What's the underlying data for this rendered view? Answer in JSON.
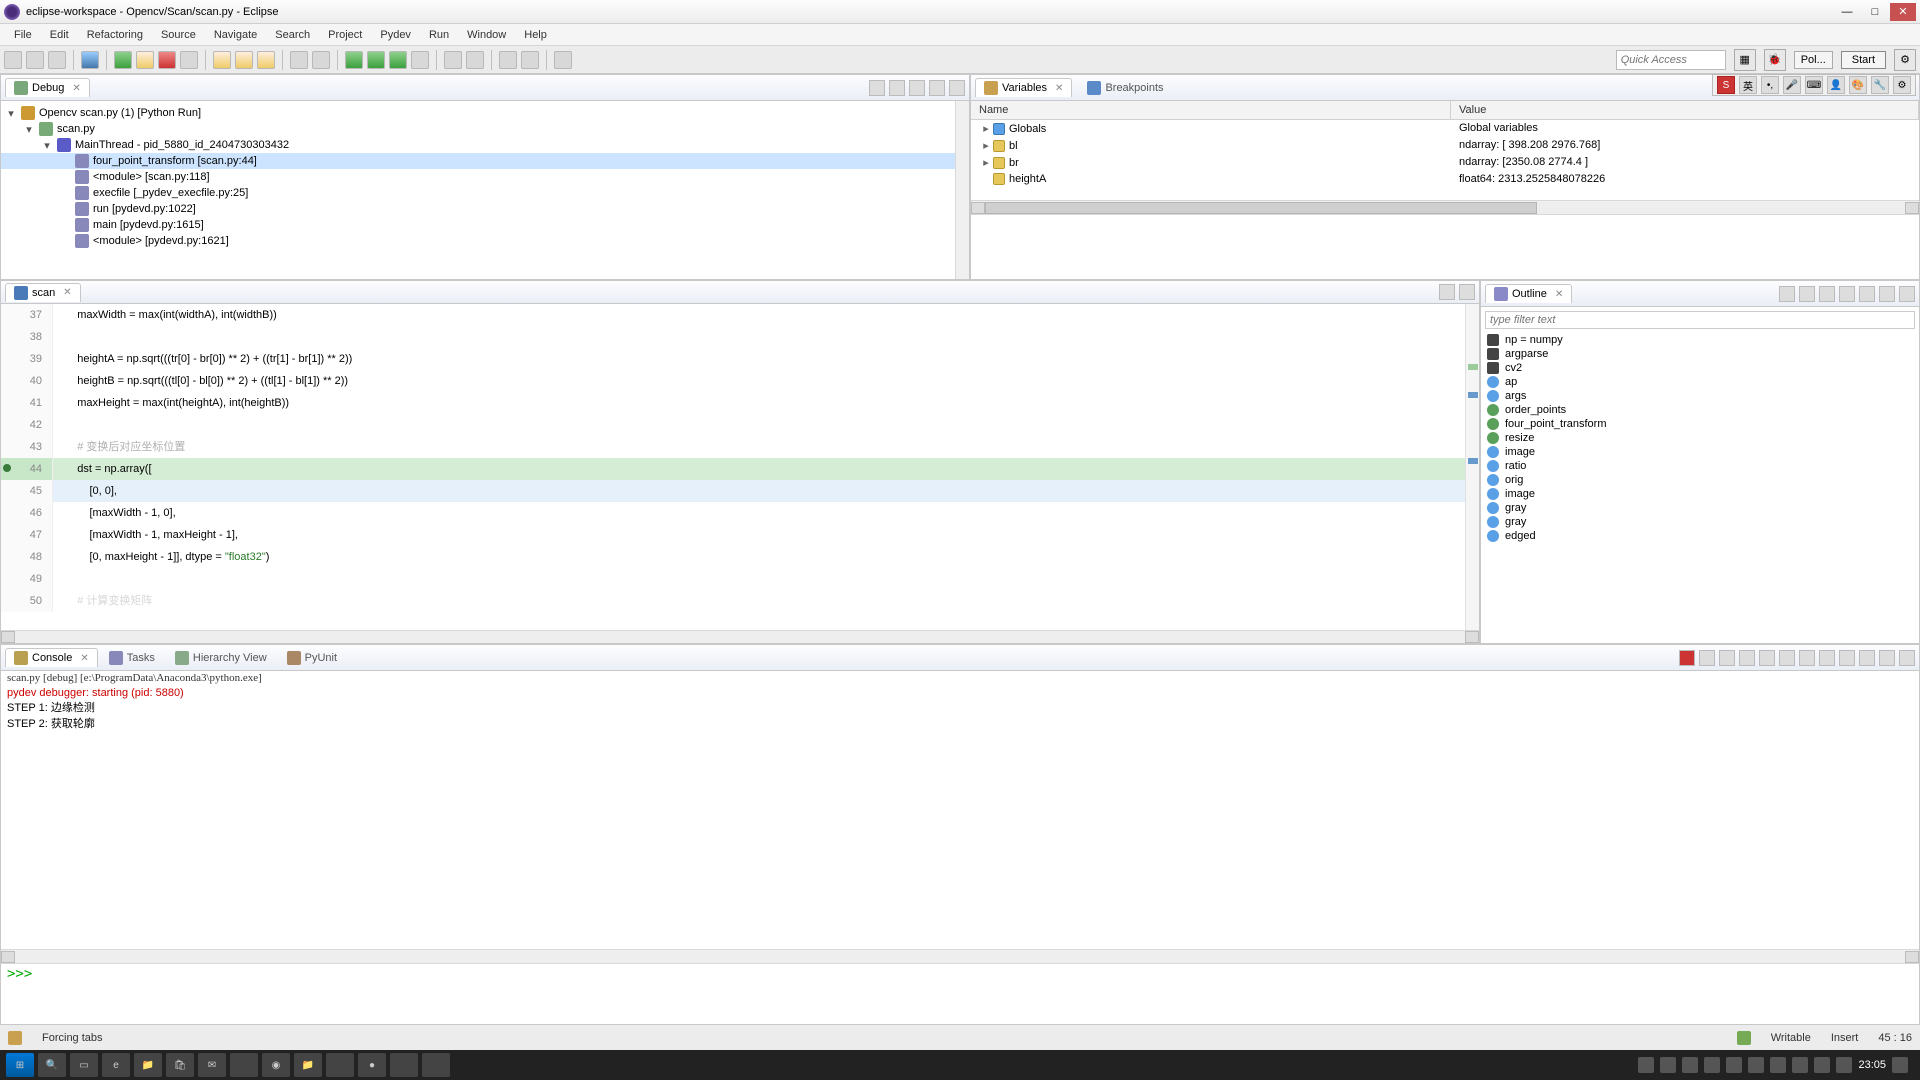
{
  "window": {
    "title": "eclipse-workspace - Opencv/Scan/scan.py - Eclipse",
    "minimize": "—",
    "maximize": "□",
    "close": "✕"
  },
  "menu": [
    "File",
    "Edit",
    "Refactoring",
    "Source",
    "Navigate",
    "Search",
    "Project",
    "Pydev",
    "Run",
    "Window",
    "Help"
  ],
  "quick_access_placeholder": "Quick Access",
  "start_btn": "Start",
  "poll_btn": "Pol...",
  "debug_view": {
    "title": "Debug",
    "nodes": [
      {
        "indent": 0,
        "icon": "bug",
        "exp": "▾",
        "label": "Opencv scan.py (1) [Python Run]"
      },
      {
        "indent": 1,
        "icon": "py",
        "exp": "▾",
        "label": "scan.py"
      },
      {
        "indent": 2,
        "icon": "thread",
        "exp": "▾",
        "label": "MainThread - pid_5880_id_2404730303432"
      },
      {
        "indent": 3,
        "icon": "frame",
        "exp": "",
        "label": "four_point_transform [scan.py:44]",
        "selected": true
      },
      {
        "indent": 3,
        "icon": "frame",
        "exp": "",
        "label": "<module> [scan.py:118]"
      },
      {
        "indent": 3,
        "icon": "frame",
        "exp": "",
        "label": "execfile [_pydev_execfile.py:25]"
      },
      {
        "indent": 3,
        "icon": "frame",
        "exp": "",
        "label": "run [pydevd.py:1022]"
      },
      {
        "indent": 3,
        "icon": "frame",
        "exp": "",
        "label": "main [pydevd.py:1615]"
      },
      {
        "indent": 3,
        "icon": "frame",
        "exp": "",
        "label": "<module> [pydevd.py:1621]"
      }
    ]
  },
  "variables_view": {
    "tab_variables": "Variables",
    "tab_breakpoints": "Breakpoints",
    "col_name": "Name",
    "col_value": "Value",
    "rows": [
      {
        "exp": "▸",
        "icon": "globals",
        "name": "Globals",
        "value": "Global variables"
      },
      {
        "exp": "▸",
        "icon": "var",
        "name": "bl",
        "value": "ndarray: [ 398.208 2976.768]"
      },
      {
        "exp": "▸",
        "icon": "var",
        "name": "br",
        "value": "ndarray: [2350.08 2774.4 ]"
      },
      {
        "exp": "",
        "icon": "var",
        "name": "heightA",
        "value": "float64: 2313.2525848078226"
      }
    ]
  },
  "editor": {
    "tab": "scan",
    "lines": [
      {
        "n": 37,
        "text": "    maxWidth = max(int(widthA), int(widthB))"
      },
      {
        "n": 38,
        "text": ""
      },
      {
        "n": 39,
        "text": "    heightA = np.sqrt(((tr[0] - br[0]) ** 2) + ((tr[1] - br[1]) ** 2))"
      },
      {
        "n": 40,
        "text": "    heightB = np.sqrt(((tl[0] - bl[0]) ** 2) + ((tl[1] - bl[1]) ** 2))"
      },
      {
        "n": 41,
        "text": "    maxHeight = max(int(heightA), int(heightB))"
      },
      {
        "n": 42,
        "text": ""
      },
      {
        "n": 43,
        "text": "    # 变换后对应坐标位置",
        "comment": true
      },
      {
        "n": 44,
        "text": "    dst = np.array([",
        "exec": true
      },
      {
        "n": 45,
        "text": "        [0, 0],",
        "hl": true,
        "caret": true
      },
      {
        "n": 46,
        "text": "        [maxWidth - 1, 0],"
      },
      {
        "n": 47,
        "text": "        [maxWidth - 1, maxHeight - 1],"
      },
      {
        "n": 48,
        "text": "        [0, maxHeight - 1]], dtype = \"float32\")",
        "hasstr": true
      },
      {
        "n": 49,
        "text": ""
      },
      {
        "n": 50,
        "text": "    # 计算变换矩阵",
        "comment": true,
        "faded": true
      }
    ]
  },
  "outline": {
    "title": "Outline",
    "filter_placeholder": "type filter text",
    "items": [
      {
        "icon": "import",
        "label": "np = numpy"
      },
      {
        "icon": "import",
        "label": "argparse"
      },
      {
        "icon": "import",
        "label": "cv2"
      },
      {
        "icon": "var",
        "label": "ap"
      },
      {
        "icon": "var",
        "label": "args"
      },
      {
        "icon": "func",
        "label": "order_points"
      },
      {
        "icon": "func",
        "label": "four_point_transform"
      },
      {
        "icon": "func",
        "label": "resize"
      },
      {
        "icon": "var",
        "label": "image"
      },
      {
        "icon": "var",
        "label": "ratio"
      },
      {
        "icon": "var",
        "label": "orig"
      },
      {
        "icon": "var",
        "label": "image"
      },
      {
        "icon": "var",
        "label": "gray"
      },
      {
        "icon": "var",
        "label": "gray"
      },
      {
        "icon": "var",
        "label": "edged"
      }
    ]
  },
  "console": {
    "tab_console": "Console",
    "tab_tasks": "Tasks",
    "tab_hierarchy": "Hierarchy View",
    "tab_pyunit": "PyUnit",
    "header": "scan.py [debug] [e:\\ProgramData\\Anaconda3\\python.exe]",
    "lines": [
      {
        "cls": "cl-red",
        "text": "pydev debugger: starting (pid: 5880)"
      },
      {
        "cls": "",
        "text": "STEP 1: 边缘检测"
      },
      {
        "cls": "",
        "text": "STEP 2: 获取轮廓"
      }
    ],
    "prompt": ">>> "
  },
  "status": {
    "left_icon": true,
    "left": "Forcing tabs",
    "writable": "Writable",
    "insert": "Insert",
    "pos": "45 : 16"
  },
  "taskbar": {
    "clock": "23:05"
  },
  "ime": {
    "lang": "英"
  }
}
